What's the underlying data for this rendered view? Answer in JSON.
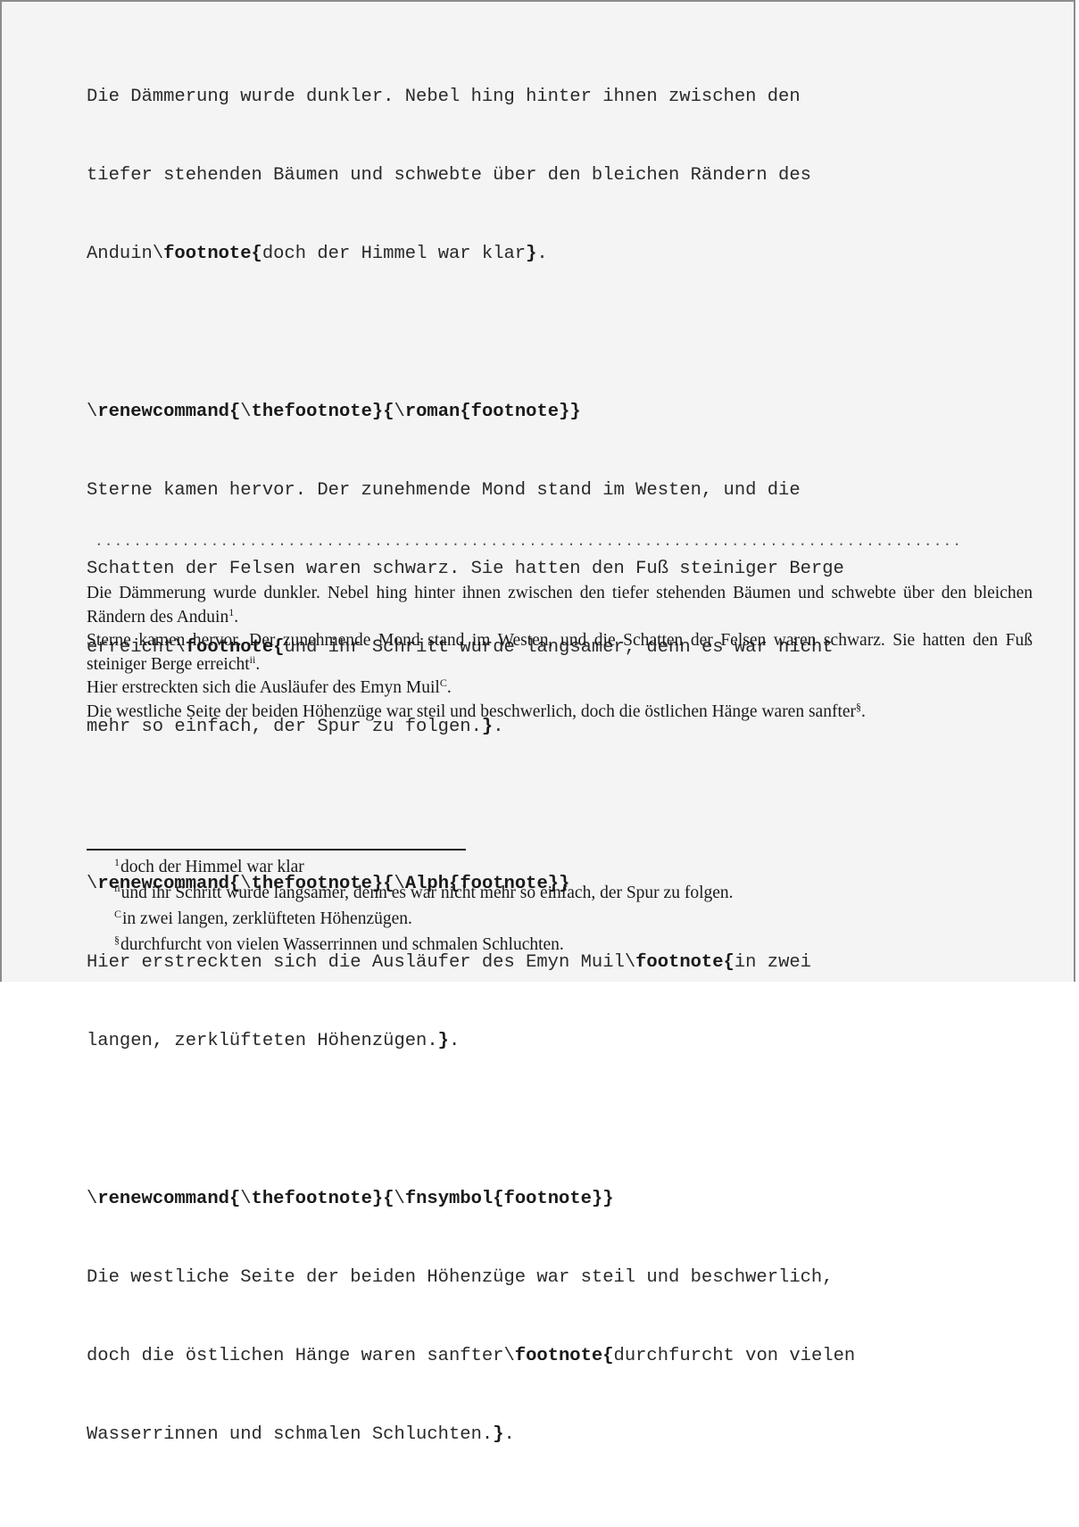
{
  "code": {
    "p1_l1": "Die Dämmerung wurde dunkler. Nebel hing hinter ihnen zwischen den",
    "p1_l2": "tiefer stehenden Bäumen und schwebte über den bleichen Rändern des",
    "p1_l3_pre": "Anduin",
    "p1_l3_cmd": "footnote",
    "p1_l3_arg": "doch der Himmel war klar",
    "p1_l3_end": ".",
    "r2_cmd": "renewcommand",
    "r2_the": "thefootnote",
    "r2_style": "roman",
    "r2_arg": "footnote",
    "p2_l1": "Sterne kamen hervor. Der zunehmende Mond stand im Westen, und die",
    "p2_l2": "Schatten der Felsen waren schwarz. Sie hatten den Fuß steiniger Berge",
    "p2_l3_pre": "erreicht",
    "p2_l3_cmd": "footnote",
    "p2_l3_arg": "und ihr Schritt wurde langsamer, denn es war nicht",
    "p2_l4_arg": "mehr so einfach, der Spur zu folgen.",
    "p2_l4_end": ".",
    "r3_cmd": "renewcommand",
    "r3_the": "thefootnote",
    "r3_style": "Alph",
    "r3_arg": "footnote",
    "p3_l1_pre": "Hier erstreckten sich die Ausläufer des Emyn Muil",
    "p3_l1_cmd": "footnote",
    "p3_l1_arg": "in zwei",
    "p3_l2_arg": "langen, zerklüfteten Höhenzügen.",
    "p3_l2_end": ".",
    "r4_cmd": "renewcommand",
    "r4_the": "thefootnote",
    "r4_style": "fnsymbol",
    "r4_arg": "footnote",
    "p4_l1": "Die westliche Seite der beiden Höhenzüge war steil und beschwerlich,",
    "p4_l2_pre": "doch die östlichen Hänge waren sanfter",
    "p4_l2_cmd": "footnote",
    "p4_l2_arg": "durchfurcht von vielen",
    "p4_l3_arg": "Wasserrinnen und schmalen Schluchten.",
    "p4_l3_end": "."
  },
  "separator": "..........................................................................................",
  "typeset": {
    "s1": "Die Dämmerung wurde dunkler. Nebel hing hinter ihnen zwischen den tiefer stehenden Bäumen und schwebte über den bleichen Rändern des Anduin",
    "m1": "1",
    "s2": "Sterne kamen hervor. Der zunehmende Mond stand im Westen, und die Schatten der Felsen waren schwarz. Sie hatten den Fuß steiniger Berge erreicht",
    "m2": "ii",
    "s3": "Hier erstreckten sich die Ausläufer des Emyn Muil",
    "m3": "C",
    "s4": "Die westliche Seite der beiden Höhenzüge war steil und beschwerlich, doch die östlichen Hänge waren sanfter",
    "m4": "§",
    "period": "."
  },
  "footnotes": [
    {
      "mark": "1",
      "text": "doch der Himmel war klar"
    },
    {
      "mark": "ii",
      "text": "und ihr Schritt wurde langsamer, denn es war nicht mehr so einfach, der Spur zu folgen."
    },
    {
      "mark": "C",
      "text": "in zwei langen, zerklüfteten Höhenzügen."
    },
    {
      "mark": "§",
      "text": "durchfurcht von vielen Wasserrinnen und schmalen Schluchten."
    }
  ]
}
